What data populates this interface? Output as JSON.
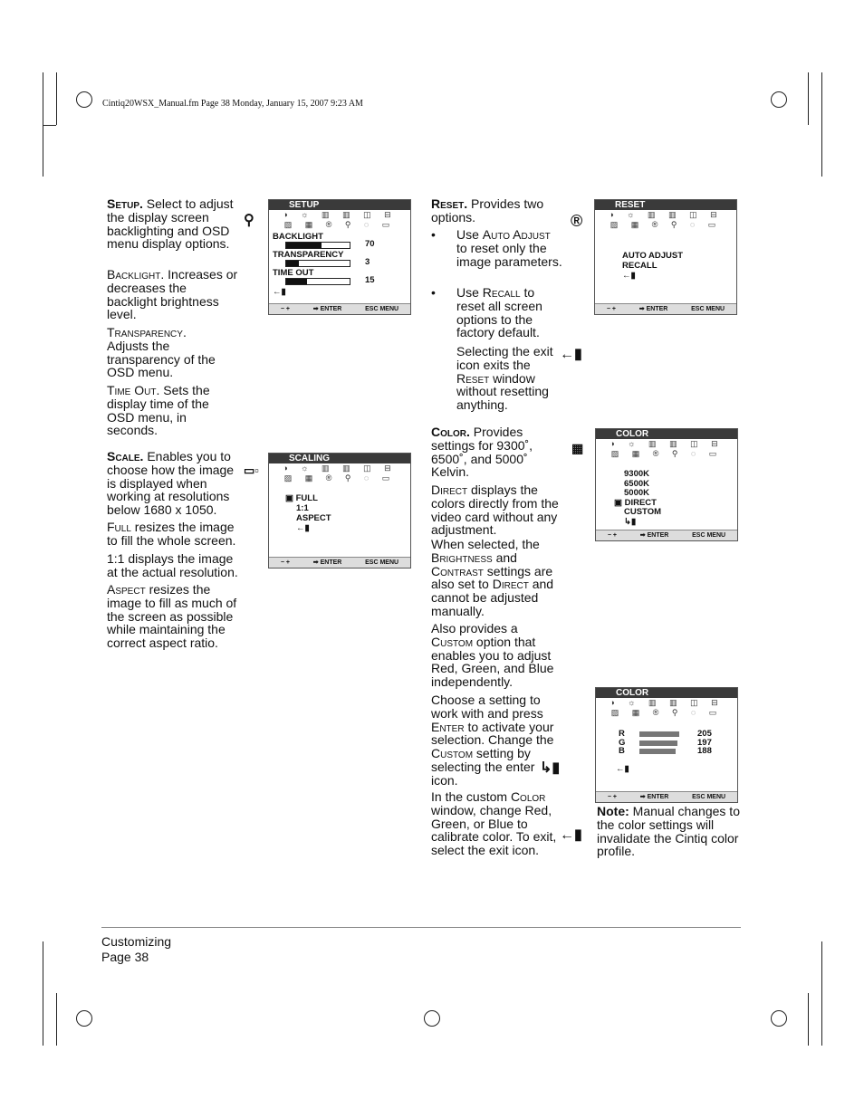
{
  "header": "Cintiq20WSX_Manual.fm  Page 38  Monday, January 15, 2007  9:23 AM",
  "left": {
    "setup": {
      "term": "Setup.",
      "text": " Select to adjust the display screen backlighting and OSD menu display options."
    },
    "backlight": {
      "term": "Backlight.",
      "text": " Increases or decreases the backlight brightness level."
    },
    "transparency": {
      "term": "Transparency.",
      "text": " Adjusts the transparency of the OSD menu."
    },
    "timeout": {
      "term": "Time Out.",
      "text": " Sets the display time of the OSD menu, in seconds."
    },
    "scale": {
      "term": "Scale.",
      "text": " Enables you to choose how the image is displayed when working at resolutions below 1680 x 1050."
    },
    "full": {
      "term": "Full",
      "text": " resizes the image to fill the whole screen."
    },
    "one": {
      "text": "1:1 displays the image at the actual resolution."
    },
    "aspect": {
      "term": "Aspect",
      "text": " resizes the image to fill as much of the screen as possible while maintaining the correct aspect ratio."
    }
  },
  "mid": {
    "reset": {
      "term": "Reset.",
      "text": " Provides two options."
    },
    "b1": {
      "a": "Use ",
      "term": "Auto Adjust",
      "text": " to reset only the image parameters."
    },
    "b2": {
      "a": "Use ",
      "term": "Recall",
      "text": " to reset all screen options to the factory default."
    },
    "exit": {
      "a": "Selecting the exit icon exits the ",
      "term": "Reset",
      "text": " window without resetting anything."
    },
    "color": {
      "term": "Color.",
      "text": " Provides settings for 9300˚, 6500˚, and 5000˚ Kelvin."
    },
    "direct": {
      "term": "Direct",
      "text": " displays the colors directly from the video card without any adjustment."
    },
    "when": {
      "a": "When selected, the ",
      "t1": "Brightness",
      "m": " and ",
      "t2": "Contrast",
      "n": " settings are also set to ",
      "t3": "Direct",
      "text": " and cannot be adjusted manually."
    },
    "also": {
      "a": "Also provides a ",
      "term": "Custom",
      "text": " option that enables you to adjust Red, Green, and Blue independently."
    },
    "choose": {
      "a": "Choose a setting to work with and press ",
      "t1": "Enter",
      "m": " to activate your selection.  Change the ",
      "t2": "Custom",
      "text": " setting by selecting the enter icon."
    },
    "custom": {
      "a": "In the custom ",
      "term": "Color",
      "text": " window, change Red, Green, or Blue to calibrate color.  To exit, select the exit icon."
    }
  },
  "note": {
    "label": "Note:",
    "text": " Manual changes to the color settings will invalidate the Cintiq color profile."
  },
  "osd_common": {
    "minus_plus": "− +",
    "enter": "➡ ENTER",
    "esc": "ESC MENU",
    "icons_row1": "◑ ☼ ▥ ▥ ◫ ⊟",
    "icons_row2": "▨ ▦ ® ⚲ ◌ ▭"
  },
  "osd_setup": {
    "title": "SETUP",
    "items": [
      {
        "label": "BACKLIGHT",
        "value": "70",
        "level": 0.55
      },
      {
        "label": "TRANSPARENCY",
        "value": "3",
        "level": 0.2
      },
      {
        "label": "TIME  OUT",
        "value": "15",
        "level": 0.33
      }
    ],
    "exit": "←▮"
  },
  "osd_scaling": {
    "title": "SCALING",
    "options": [
      "▣ FULL",
      "1:1",
      "ASPECT"
    ],
    "exit": "←▮"
  },
  "osd_reset": {
    "title": "RESET",
    "options": [
      "AUTO  ADJUST",
      "RECALL"
    ],
    "exit": "←▮"
  },
  "osd_color": {
    "title": "COLOR",
    "options": [
      "9300K",
      "6500K",
      "5000K",
      "▣ DIRECT",
      "CUSTOM"
    ],
    "enter_icon": "↳▮"
  },
  "osd_custom": {
    "title": "COLOR",
    "channels": [
      {
        "label": "R",
        "value": "205"
      },
      {
        "label": "G",
        "value": "197"
      },
      {
        "label": "B",
        "value": "188"
      }
    ],
    "exit": "←▮"
  },
  "side_icons": {
    "setup": "⚲",
    "reset": "®",
    "color": "▦",
    "scale": "▭▫",
    "exit": "←▮",
    "enter": "↳▮"
  },
  "footer": {
    "section": "Customizing",
    "page": "Page  38"
  }
}
